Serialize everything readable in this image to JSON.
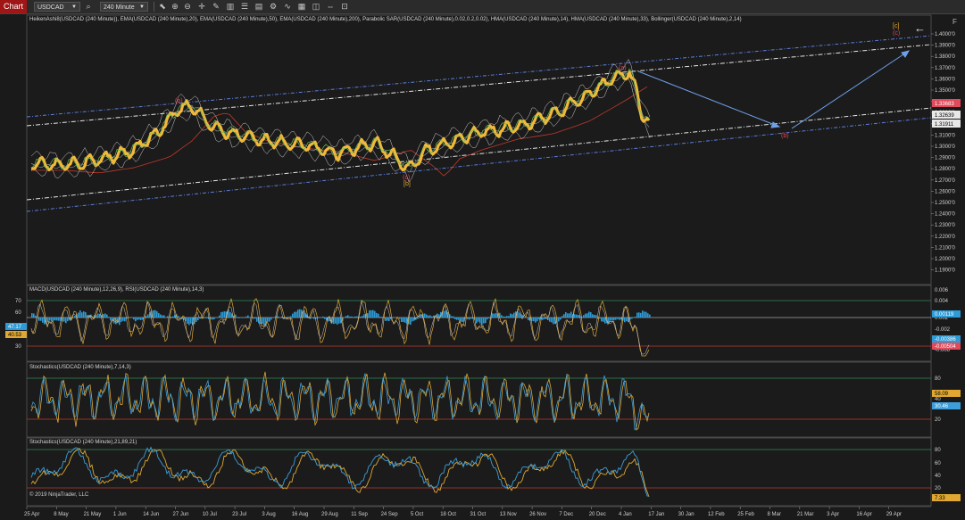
{
  "toolbar": {
    "chart_badge": "Chart",
    "instrument": "USDCAD",
    "interval": "240 Minute",
    "icons": [
      "search-icon",
      "pointer-icon",
      "zoom-in-icon",
      "zoom-out-icon",
      "crosshair-icon",
      "draw-icon",
      "bar-style-icon",
      "properties-icon",
      "template-icon",
      "strategy-icon",
      "indicator-icon",
      "data-box-icon",
      "snapshot-icon",
      "scroll-icon",
      "lock-icon"
    ]
  },
  "price_panel": {
    "title": "HeikenAshi8(USDCAD (240 Minute)), EMA(USDCAD (240 Minute),20), EMA(USDCAD (240 Minute),50), EMA(USDCAD (240 Minute),200), Parabolic SAR(USDCAD (240 Minute),0.02,0.2,0.02), HMA(USDCAD (240 Minute),14), HMA(USDCAD (240 Minute),33), Bollinger(USDCAD (240 Minute),2,14)",
    "axis_labels": [
      "1.4000'0",
      "1.3900'0",
      "1.3800'0",
      "1.3700'0",
      "1.3600'0",
      "1.3500'0",
      "1.3400'0",
      "1.3300'0",
      "1.3200'0",
      "1.3100'0",
      "1.3000'0",
      "1.2900'0",
      "1.2800'0",
      "1.2700'0",
      "1.2600'0",
      "1.2500'0",
      "1.2400'0",
      "1.2300'0",
      "1.2200'0",
      "1.2100'0",
      "1.2000'0",
      "1.1900'0"
    ],
    "price_tags": [
      {
        "value": "1.33683",
        "color": "#e04a5a"
      },
      {
        "value": "1.32639",
        "color": "#e8e8e8"
      },
      {
        "value": "1.31911",
        "color": "#e8e8e8"
      }
    ],
    "wave_labels": {
      "b_top": "(b)",
      "a": "(a)",
      "c_bottom": "(c)",
      "B": "[b]",
      "C_box": "[c]",
      "c_proj": "(c)",
      "b_proj": "(b)"
    },
    "back_arrow": "←",
    "f_label": "F"
  },
  "macd_panel": {
    "title": "MACD(USDCAD (240 Minute),12,26,9), RSI(USDCAD (240 Minute),14,3)",
    "left_labels": [
      "70",
      "60",
      "30"
    ],
    "left_tags": [
      {
        "value": "47.17",
        "color": "#2e9bd6"
      },
      {
        "value": "40.53",
        "color": "#e0a832"
      }
    ],
    "right_labels": [
      "0.006",
      "0.004",
      "0.002",
      "-0.002",
      "-0.006"
    ],
    "right_tags": [
      {
        "value": "0.00119",
        "color": "#2e9bd6"
      },
      {
        "value": "-0.00386",
        "color": "#2e9bd6"
      },
      {
        "value": "-0.00504",
        "color": "#e04a5a"
      }
    ]
  },
  "stoch1_panel": {
    "title": "Stochastics(USDCAD (240 Minute),7,14,3)",
    "right_labels": [
      "80",
      "60",
      "40",
      "20"
    ],
    "right_tags": [
      {
        "value": "58.09",
        "color": "#e0a832"
      },
      {
        "value": "30.46",
        "color": "#2e9bd6"
      }
    ]
  },
  "stoch2_panel": {
    "title": "Stochastics(USDCAD (240 Minute),21,89,21)",
    "right_labels": [
      "80",
      "60",
      "40",
      "20"
    ],
    "right_tags": [
      {
        "value": "7.33",
        "color": "#e0a832"
      }
    ],
    "copyright": "© 2019 NinjaTrader, LLC"
  },
  "date_axis": [
    "25 Apr",
    "8 May",
    "21 May",
    "1 Jun",
    "14 Jun",
    "27 Jun",
    "10 Jul",
    "23 Jul",
    "3 Aug",
    "16 Aug",
    "29 Aug",
    "11 Sep",
    "24 Sep",
    "5 Oct",
    "18 Oct",
    "31 Oct",
    "13 Nov",
    "26 Nov",
    "7 Dec",
    "20 Dec",
    "4 Jan",
    "17 Jan",
    "30 Jan",
    "12 Feb",
    "25 Feb",
    "8 Mar",
    "21 Mar",
    "3 Apr",
    "16 Apr",
    "29 Apr"
  ],
  "colors": {
    "candles": "#f0b93a",
    "channel_blue": "#5b7fe0",
    "channel_white": "#e6e6e6",
    "projection": "#6ea0e8",
    "ema200": "#c0392b",
    "macd_hist": "#2e9bd6",
    "rsi": "#e0a832",
    "stoch_blue": "#3d9ed9",
    "stoch_orange": "#e0a832",
    "overbought": "#2e8b57",
    "oversold": "#c0392b"
  }
}
